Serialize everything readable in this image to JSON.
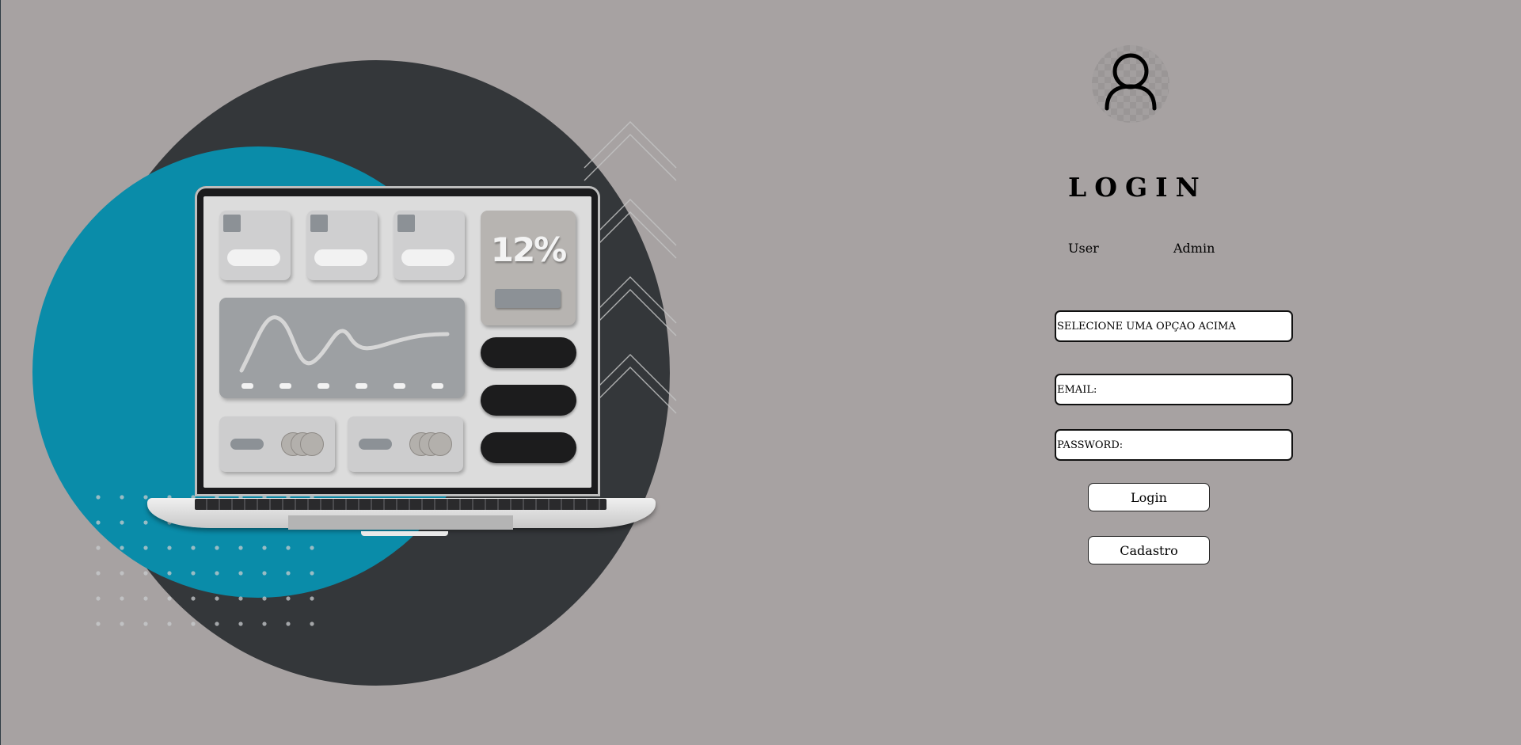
{
  "illustration": {
    "screen_percent": "12%",
    "colors": {
      "background": "#a7a2a2",
      "dark_circle": "#34373a",
      "blue_circle": "#0a8ca9"
    }
  },
  "login": {
    "avatar_icon": "user-icon",
    "title": "LOGIN",
    "roles": [
      "User",
      "Admin"
    ],
    "select_placeholder": "SELECIONE UMA OPÇÃO ACIMA",
    "email_placeholder": "EMAIL:",
    "password_placeholder": "PASSWORD:",
    "login_button": "Login",
    "register_button": "Cadastro"
  }
}
